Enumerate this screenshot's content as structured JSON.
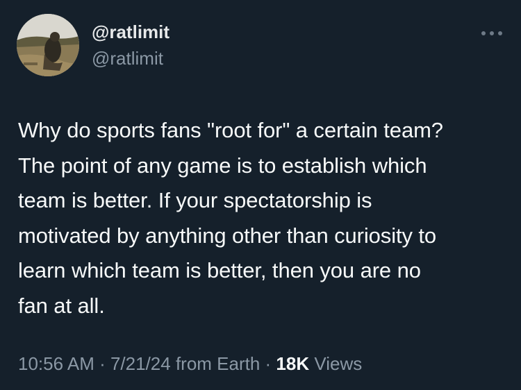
{
  "user": {
    "display_name": "@ratlimit",
    "handle": "@ratlimit",
    "avatar_icon": "avatar-photo"
  },
  "more_icon": "more-horizontal-icon",
  "tweet": {
    "lines": [
      "Why do sports fans \"root for\" a certain team?",
      "The point of any game is to establish which",
      "team is better. If your spectatorship is",
      "motivated by anything other than curiosity to",
      "learn which team is better, then you are no",
      "fan at all."
    ]
  },
  "meta": {
    "time": "10:56 AM",
    "separator1": " · ",
    "date": "7/21/24",
    "source": " from Earth",
    "separator2": " · ",
    "views_count": "18K",
    "views_label": " Views"
  },
  "colors": {
    "background": "#15202b",
    "text": "#f7f9f9",
    "secondary_text": "#8b98a5"
  }
}
